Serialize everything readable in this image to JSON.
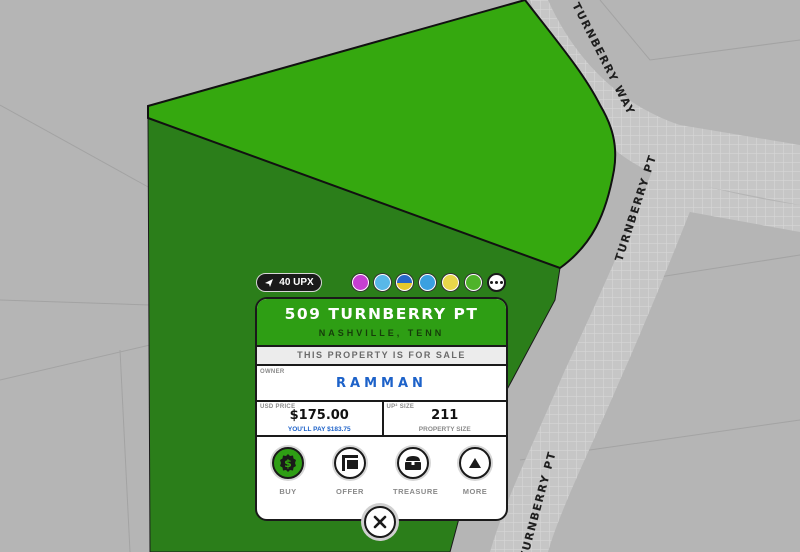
{
  "map": {
    "roads": [
      "TURNBERRY WAY",
      "TURNBERRY PT",
      "TURNBERRY PT"
    ],
    "colors": {
      "land": "#b5b5b5",
      "road": "#c8c8c8",
      "parcel_selected": "#35a80f",
      "parcel_adjacent": "#2b7e1a"
    }
  },
  "travel": {
    "icon": "send-icon",
    "label": "40 UPX"
  },
  "collections": [
    {
      "name": "collection-badge-1",
      "color": "#c63fd1"
    },
    {
      "name": "collection-badge-2",
      "color": "#58b8e8"
    },
    {
      "name": "collection-badge-3",
      "color": "#2767c7"
    },
    {
      "name": "collection-badge-4",
      "color": "#3aa0e0"
    },
    {
      "name": "collection-badge-5",
      "color": "#e8d74a"
    },
    {
      "name": "collection-badge-6",
      "color": "#4fb32a"
    }
  ],
  "property": {
    "address": "509 TURNBERRY PT",
    "city": "NASHVILLE, TENN",
    "status": "THIS PROPERTY IS FOR SALE",
    "owner_caption": "OWNER",
    "owner": "RAMMAN",
    "price_caption": "USD PRICE",
    "price": "$175.00",
    "you_pay": "YOU'LL PAY $183.75",
    "size_caption": "UP² SIZE",
    "size": "211",
    "size_label": "PROPERTY SIZE"
  },
  "actions": [
    {
      "label": "BUY",
      "icon": "dollar-coin-icon"
    },
    {
      "label": "OFFER",
      "icon": "offer-sign-icon"
    },
    {
      "label": "TREASURE",
      "icon": "treasure-chest-icon"
    },
    {
      "label": "MORE",
      "icon": "triangle-up-icon"
    }
  ],
  "close": {
    "icon": "close-icon"
  }
}
